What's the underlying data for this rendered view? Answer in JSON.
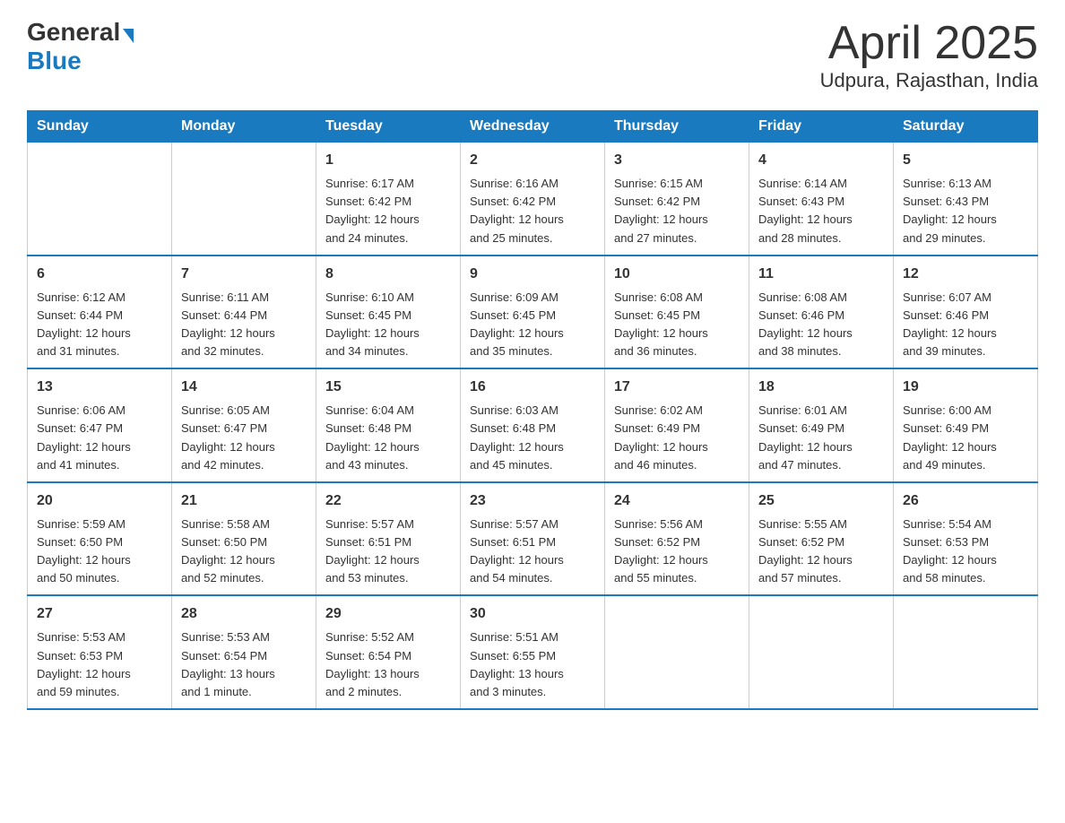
{
  "header": {
    "logo_general": "General",
    "logo_blue": "Blue",
    "title": "April 2025",
    "subtitle": "Udpura, Rajasthan, India"
  },
  "calendar": {
    "days_of_week": [
      "Sunday",
      "Monday",
      "Tuesday",
      "Wednesday",
      "Thursday",
      "Friday",
      "Saturday"
    ],
    "weeks": [
      [
        {
          "day": "",
          "info": ""
        },
        {
          "day": "",
          "info": ""
        },
        {
          "day": "1",
          "info": "Sunrise: 6:17 AM\nSunset: 6:42 PM\nDaylight: 12 hours\nand 24 minutes."
        },
        {
          "day": "2",
          "info": "Sunrise: 6:16 AM\nSunset: 6:42 PM\nDaylight: 12 hours\nand 25 minutes."
        },
        {
          "day": "3",
          "info": "Sunrise: 6:15 AM\nSunset: 6:42 PM\nDaylight: 12 hours\nand 27 minutes."
        },
        {
          "day": "4",
          "info": "Sunrise: 6:14 AM\nSunset: 6:43 PM\nDaylight: 12 hours\nand 28 minutes."
        },
        {
          "day": "5",
          "info": "Sunrise: 6:13 AM\nSunset: 6:43 PM\nDaylight: 12 hours\nand 29 minutes."
        }
      ],
      [
        {
          "day": "6",
          "info": "Sunrise: 6:12 AM\nSunset: 6:44 PM\nDaylight: 12 hours\nand 31 minutes."
        },
        {
          "day": "7",
          "info": "Sunrise: 6:11 AM\nSunset: 6:44 PM\nDaylight: 12 hours\nand 32 minutes."
        },
        {
          "day": "8",
          "info": "Sunrise: 6:10 AM\nSunset: 6:45 PM\nDaylight: 12 hours\nand 34 minutes."
        },
        {
          "day": "9",
          "info": "Sunrise: 6:09 AM\nSunset: 6:45 PM\nDaylight: 12 hours\nand 35 minutes."
        },
        {
          "day": "10",
          "info": "Sunrise: 6:08 AM\nSunset: 6:45 PM\nDaylight: 12 hours\nand 36 minutes."
        },
        {
          "day": "11",
          "info": "Sunrise: 6:08 AM\nSunset: 6:46 PM\nDaylight: 12 hours\nand 38 minutes."
        },
        {
          "day": "12",
          "info": "Sunrise: 6:07 AM\nSunset: 6:46 PM\nDaylight: 12 hours\nand 39 minutes."
        }
      ],
      [
        {
          "day": "13",
          "info": "Sunrise: 6:06 AM\nSunset: 6:47 PM\nDaylight: 12 hours\nand 41 minutes."
        },
        {
          "day": "14",
          "info": "Sunrise: 6:05 AM\nSunset: 6:47 PM\nDaylight: 12 hours\nand 42 minutes."
        },
        {
          "day": "15",
          "info": "Sunrise: 6:04 AM\nSunset: 6:48 PM\nDaylight: 12 hours\nand 43 minutes."
        },
        {
          "day": "16",
          "info": "Sunrise: 6:03 AM\nSunset: 6:48 PM\nDaylight: 12 hours\nand 45 minutes."
        },
        {
          "day": "17",
          "info": "Sunrise: 6:02 AM\nSunset: 6:49 PM\nDaylight: 12 hours\nand 46 minutes."
        },
        {
          "day": "18",
          "info": "Sunrise: 6:01 AM\nSunset: 6:49 PM\nDaylight: 12 hours\nand 47 minutes."
        },
        {
          "day": "19",
          "info": "Sunrise: 6:00 AM\nSunset: 6:49 PM\nDaylight: 12 hours\nand 49 minutes."
        }
      ],
      [
        {
          "day": "20",
          "info": "Sunrise: 5:59 AM\nSunset: 6:50 PM\nDaylight: 12 hours\nand 50 minutes."
        },
        {
          "day": "21",
          "info": "Sunrise: 5:58 AM\nSunset: 6:50 PM\nDaylight: 12 hours\nand 52 minutes."
        },
        {
          "day": "22",
          "info": "Sunrise: 5:57 AM\nSunset: 6:51 PM\nDaylight: 12 hours\nand 53 minutes."
        },
        {
          "day": "23",
          "info": "Sunrise: 5:57 AM\nSunset: 6:51 PM\nDaylight: 12 hours\nand 54 minutes."
        },
        {
          "day": "24",
          "info": "Sunrise: 5:56 AM\nSunset: 6:52 PM\nDaylight: 12 hours\nand 55 minutes."
        },
        {
          "day": "25",
          "info": "Sunrise: 5:55 AM\nSunset: 6:52 PM\nDaylight: 12 hours\nand 57 minutes."
        },
        {
          "day": "26",
          "info": "Sunrise: 5:54 AM\nSunset: 6:53 PM\nDaylight: 12 hours\nand 58 minutes."
        }
      ],
      [
        {
          "day": "27",
          "info": "Sunrise: 5:53 AM\nSunset: 6:53 PM\nDaylight: 12 hours\nand 59 minutes."
        },
        {
          "day": "28",
          "info": "Sunrise: 5:53 AM\nSunset: 6:54 PM\nDaylight: 13 hours\nand 1 minute."
        },
        {
          "day": "29",
          "info": "Sunrise: 5:52 AM\nSunset: 6:54 PM\nDaylight: 13 hours\nand 2 minutes."
        },
        {
          "day": "30",
          "info": "Sunrise: 5:51 AM\nSunset: 6:55 PM\nDaylight: 13 hours\nand 3 minutes."
        },
        {
          "day": "",
          "info": ""
        },
        {
          "day": "",
          "info": ""
        },
        {
          "day": "",
          "info": ""
        }
      ]
    ]
  }
}
